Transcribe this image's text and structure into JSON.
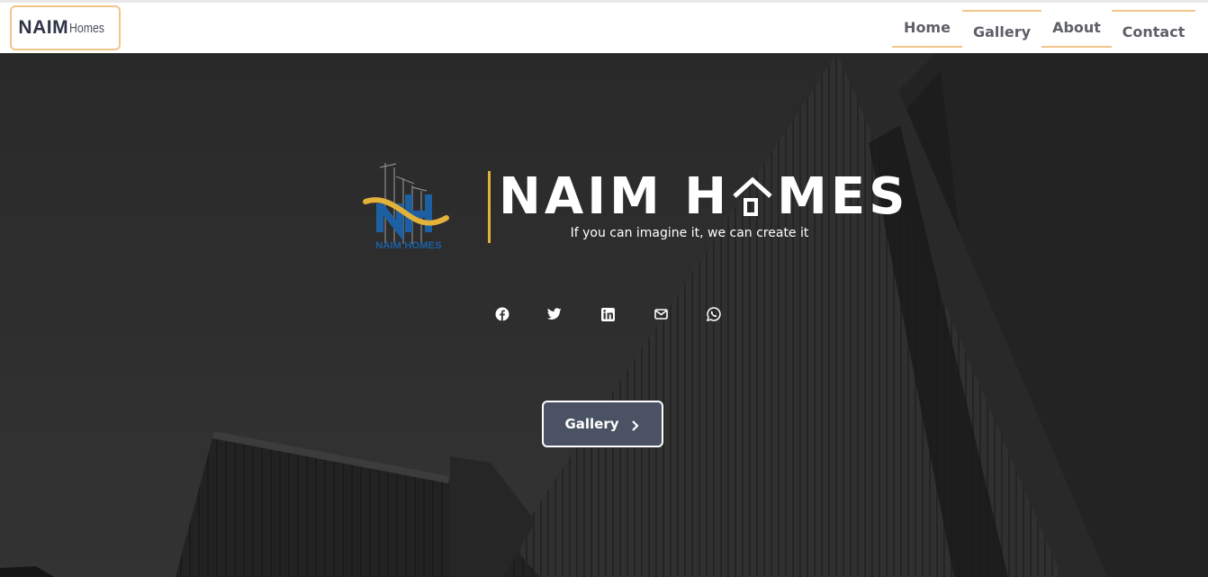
{
  "navbar": {
    "brand_main": "NAIM",
    "brand_sub": "Homes",
    "links": [
      {
        "label": "Home"
      },
      {
        "label": "Gallery"
      },
      {
        "label": "About"
      },
      {
        "label": "Contact"
      }
    ],
    "accent_color": "#f2c58a"
  },
  "hero": {
    "logo_text": "NAIM HOMES",
    "title_left": "NAIM H",
    "title_right": "MES",
    "tagline": "If you can imagine it, we can create it",
    "social_icons": [
      "facebook-icon",
      "twitter-icon",
      "linkedin-icon",
      "mail-icon",
      "whatsapp-icon"
    ],
    "cta_label": "Gallery",
    "accent_gold": "#e2b23a",
    "button_bg": "#4a5263"
  }
}
